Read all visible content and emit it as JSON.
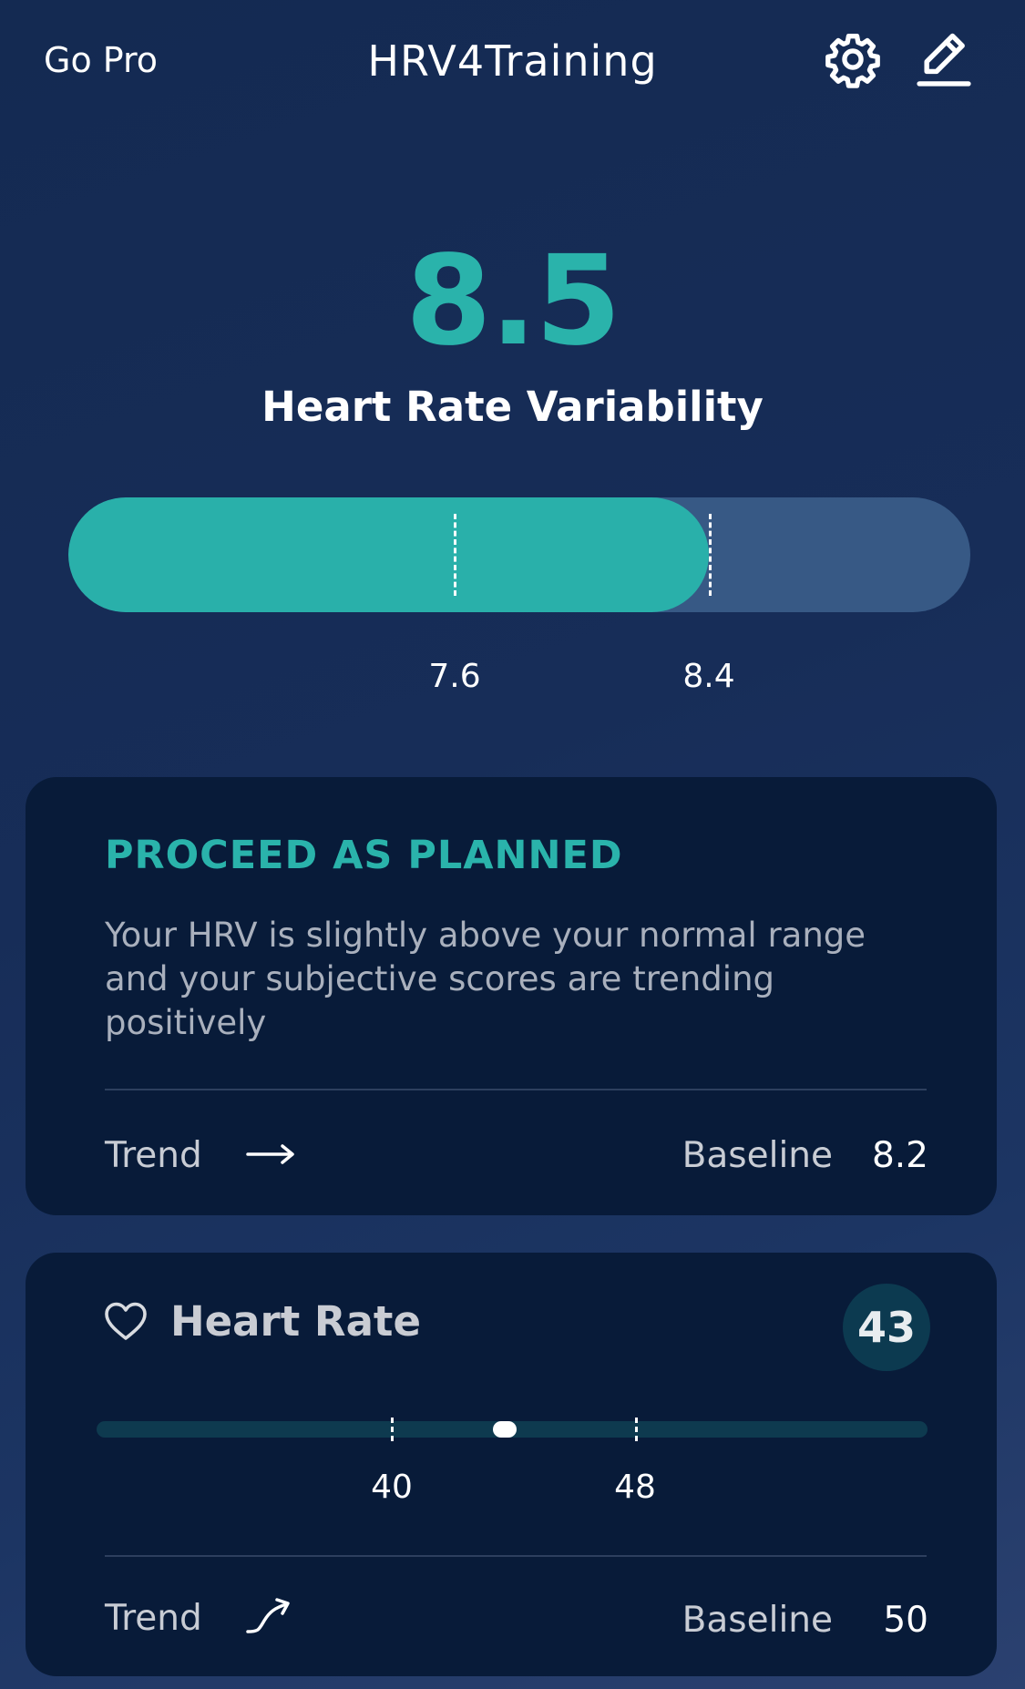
{
  "header": {
    "go_pro_label": "Go Pro",
    "title": "HRV4Training",
    "settings_icon": "gear-icon",
    "edit_icon": "pencil-icon"
  },
  "hrv": {
    "value": "8.5",
    "label": "Heart Rate Variability",
    "normal_range_low": "7.6",
    "normal_range_high": "8.4",
    "gauge_fill_fraction": 0.71,
    "fill_color": "#29b0aa",
    "track_color": "#375985"
  },
  "advice_card": {
    "title": "PROCEED AS PLANNED",
    "description": "Your HRV is slightly above your normal range and your subjective scores are trending positively",
    "trend_label": "Trend",
    "trend_icon": "arrow-right-icon",
    "baseline_label": "Baseline",
    "baseline_value": "8.2"
  },
  "heart_rate_card": {
    "icon": "heart-icon",
    "title": "Heart Rate",
    "value": "43",
    "normal_range_low": "40",
    "normal_range_high": "48",
    "trend_label": "Trend",
    "trend_icon": "trend-up-icon",
    "baseline_label": "Baseline",
    "baseline_value": "50"
  },
  "colors": {
    "accent": "#2ab3ab",
    "card_background": "#081b39",
    "page_background": "#172d58"
  }
}
